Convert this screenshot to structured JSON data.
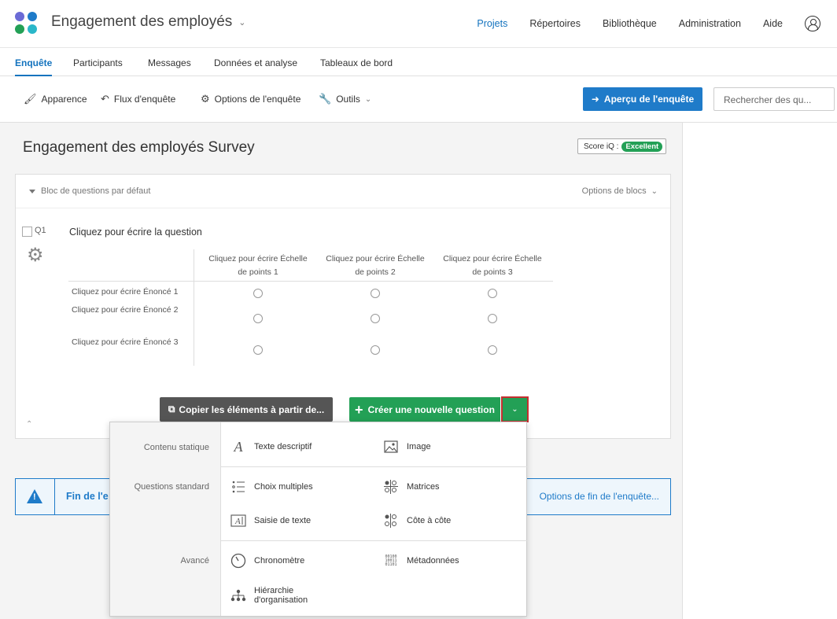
{
  "header": {
    "app_title": "Engagement des employés",
    "nav": [
      {
        "label": "Projets",
        "active": true
      },
      {
        "label": "Répertoires",
        "active": false
      },
      {
        "label": "Bibliothèque",
        "active": false
      },
      {
        "label": "Administration",
        "active": false
      },
      {
        "label": "Aide",
        "active": false
      }
    ],
    "logo_colors": [
      "#6b6bd6",
      "#1f7bc9",
      "#23a056",
      "#2ab7c9"
    ]
  },
  "tabs": [
    {
      "label": "Enquête",
      "active": true
    },
    {
      "label": "Participants",
      "active": false
    },
    {
      "label": "Messages",
      "active": false
    },
    {
      "label": "Données et analyse",
      "active": false
    },
    {
      "label": "Tableaux de bord",
      "active": false
    }
  ],
  "toolbar": {
    "appearance": "Apparence",
    "flow": "Flux d'enquête",
    "options": "Options de l'enquête",
    "tools": "Outils",
    "preview": "Aperçu de l'enquête",
    "search_placeholder": "Rechercher des qu..."
  },
  "survey": {
    "title": "Engagement des employés Survey",
    "score_label": "Score iQ :",
    "score_value": "Excellent"
  },
  "block": {
    "name": "Bloc de questions par défaut",
    "options": "Options de blocs",
    "question": {
      "number": "Q1",
      "text": "Cliquez pour écrire la question",
      "columns": [
        "Cliquez pour écrire Échelle de points 1",
        "Cliquez pour écrire Échelle de points 2",
        "Cliquez pour écrire Échelle de points 3"
      ],
      "rows": [
        "Cliquez pour écrire Énoncé 1",
        "Cliquez pour écrire Énoncé 2",
        "Cliquez pour écrire Énoncé 3"
      ]
    },
    "copy_button": "Copier les éléments à partir de...",
    "new_button": "Créer une nouvelle question"
  },
  "end": {
    "text": "Fin de l'e",
    "options": "Options de fin de l'enquête..."
  },
  "menu": {
    "categories": [
      "Contenu statique",
      "Questions standard",
      "Avancé"
    ],
    "items": [
      {
        "label": "Texte descriptif",
        "icon": "text-a-icon"
      },
      {
        "label": "Image",
        "icon": "image-icon"
      },
      {
        "label": "Choix multiples",
        "icon": "list-icon"
      },
      {
        "label": "Matrices",
        "icon": "matrix-icon"
      },
      {
        "label": "Saisie de texte",
        "icon": "text-entry-icon"
      },
      {
        "label": "Côte à côte",
        "icon": "side-by-side-icon"
      },
      {
        "label": "Chronomètre",
        "icon": "timer-icon"
      },
      {
        "label": "Métadonnées",
        "icon": "binary-icon"
      },
      {
        "label": "Hiérarchie d'organisation",
        "line1": "Hiérarchie",
        "line2": "d'organisation",
        "icon": "org-chart-icon"
      }
    ]
  }
}
